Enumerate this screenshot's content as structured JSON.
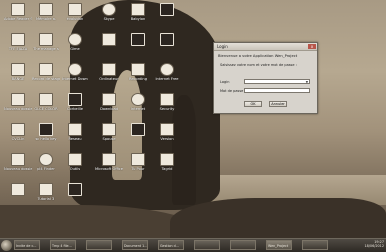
{
  "desktop": {
    "icons": [
      {
        "label": "Adobe Reader 9",
        "style": "light"
      },
      {
        "label": "Mémoire a.",
        "style": "light"
      },
      {
        "label": "évolution",
        "style": "light"
      },
      {
        "label": "Skype",
        "style": "round"
      },
      {
        "label": "Babylon",
        "style": "light"
      },
      {
        "label": "",
        "style": "dark"
      },
      {
        "label": "TFE EJAZA",
        "style": "light"
      },
      {
        "label": "The manage s",
        "style": "light"
      },
      {
        "label": "Gime",
        "style": "round"
      },
      {
        "label": "",
        "style": "light"
      },
      {
        "label": "",
        "style": "dark"
      },
      {
        "label": "",
        "style": "dark"
      },
      {
        "label": "BANGE",
        "style": "light"
      },
      {
        "label": "Record de stage",
        "style": "light"
      },
      {
        "label": "Internet Down",
        "style": "round"
      },
      {
        "label": "Ordinateur",
        "style": "light"
      },
      {
        "label": "Recording",
        "style": "light"
      },
      {
        "label": "Internet Free",
        "style": "round"
      },
      {
        "label": "Nouveau dossier",
        "style": "light"
      },
      {
        "label": "GLCE COLOR",
        "style": "light"
      },
      {
        "label": "Corbeille",
        "style": "dark"
      },
      {
        "label": "Download",
        "style": "light"
      },
      {
        "label": "Internet",
        "style": "round"
      },
      {
        "label": "Security",
        "style": "light"
      },
      {
        "label": "CVCLin",
        "style": "light"
      },
      {
        "label": "sc hello key",
        "style": "dark"
      },
      {
        "label": "Reseau",
        "style": "light"
      },
      {
        "label": "Spouse",
        "style": "light"
      },
      {
        "label": "",
        "style": "dark"
      },
      {
        "label": "Version",
        "style": "light"
      },
      {
        "label": "Nouveau dossier",
        "style": "light"
      },
      {
        "label": "pl4 Finder",
        "style": "round"
      },
      {
        "label": "Outils",
        "style": "light"
      },
      {
        "label": "Microsoft Office Word 2007",
        "style": "light"
      },
      {
        "label": "Tu Pour",
        "style": "light"
      },
      {
        "label": "Tagrid",
        "style": "light"
      },
      {
        "label": "",
        "style": "light"
      },
      {
        "label": "Tutorial 3",
        "style": "light"
      },
      {
        "label": "",
        "style": "dark"
      }
    ]
  },
  "dialog": {
    "title": "Login",
    "close_label": "x",
    "welcome_text": "Bienvenue a votre Application Wen_Project",
    "instruction_text": "Saisissez votre nom et votre mot de passe :",
    "login_label": "Login",
    "login_value": "",
    "password_label": "Mot de passe",
    "password_value": "",
    "ok_label": "OK",
    "cancel_label": "Annuler"
  },
  "taskbar": {
    "buttons": [
      {
        "label": "Invite de c...",
        "active": false
      },
      {
        "label": "Tmp 4 file...",
        "active": false
      },
      {
        "label": "",
        "active": false
      },
      {
        "label": "Document 1...",
        "active": false
      },
      {
        "label": "Gestion d...",
        "active": false
      },
      {
        "label": "",
        "active": false
      },
      {
        "label": "",
        "active": false
      },
      {
        "label": "Wen_Project",
        "active": true
      },
      {
        "label": "",
        "active": false
      }
    ],
    "tray_time": "19:27",
    "tray_date": "18/06/2012"
  }
}
